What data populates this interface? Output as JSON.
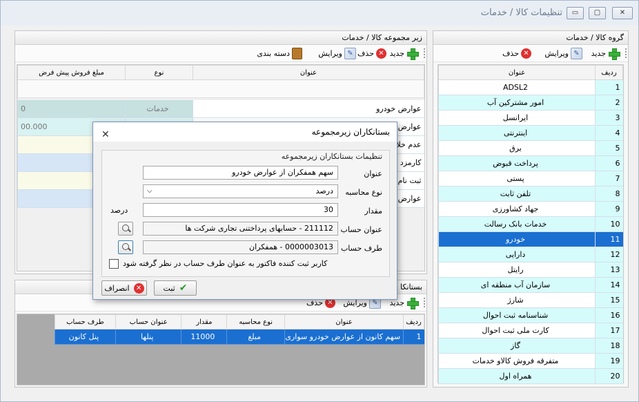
{
  "window": {
    "title": "تنظیمات کالا / خدمات",
    "btn_min": "▭",
    "btn_max": "▢",
    "btn_close": "✕"
  },
  "group_panel": {
    "title": "گروه کالا / خدمات",
    "toolbar": {
      "add": "جدید",
      "edit": "ویرایش",
      "delete": "حذف"
    },
    "columns": {
      "row": "ردیف",
      "title": "عنوان"
    },
    "rows": [
      {
        "n": "1",
        "t": "ADSL2"
      },
      {
        "n": "2",
        "t": "امور مشترکین آب"
      },
      {
        "n": "3",
        "t": "ایرانسل"
      },
      {
        "n": "4",
        "t": "اینترنتی"
      },
      {
        "n": "5",
        "t": "برق"
      },
      {
        "n": "6",
        "t": "پرداخت قبوض"
      },
      {
        "n": "7",
        "t": "پستی"
      },
      {
        "n": "8",
        "t": "تلفن ثابت"
      },
      {
        "n": "9",
        "t": "جهاد کشاورزی"
      },
      {
        "n": "10",
        "t": "خدمات بانک رسالت"
      },
      {
        "n": "11",
        "t": "خودرو"
      },
      {
        "n": "12",
        "t": "دارایی"
      },
      {
        "n": "13",
        "t": "رایتل"
      },
      {
        "n": "14",
        "t": "سازمان آب منطقه ای"
      },
      {
        "n": "15",
        "t": "شارژ"
      },
      {
        "n": "16",
        "t": "شناسنامه ثبت احوال"
      },
      {
        "n": "17",
        "t": "کارت ملی ثبت احوال"
      },
      {
        "n": "18",
        "t": "گاز"
      },
      {
        "n": "19",
        "t": "متفرقه فروش کالاو خدمات"
      },
      {
        "n": "20",
        "t": "همراه اول"
      }
    ]
  },
  "sub_panel": {
    "title": "زیر مجموعه کالا / خدمات",
    "toolbar": {
      "add": "جدید",
      "delete": "حذف",
      "edit": "ویرایش",
      "category": "دسته بندی"
    },
    "columns": {
      "title": "عنوان",
      "type": "نوع",
      "price": "مبلغ فروش پیش فرض"
    },
    "rows": [
      {
        "t": "عوارض خودرو",
        "type": "خدمات",
        "price": "0"
      },
      {
        "t": "عوارض خ",
        "type": "",
        "price": "00.000"
      },
      {
        "t": "عدم خلا",
        "type": "",
        "price": ""
      },
      {
        "t": "کارمزد پ",
        "type": "",
        "price": ""
      },
      {
        "t": "ثبت نام",
        "type": "",
        "price": ""
      },
      {
        "t": "عوارض",
        "type": "",
        "price": ""
      }
    ]
  },
  "creditors_panel": {
    "title": "بستانکا",
    "toolbar": {
      "add": "جدید",
      "edit": "ویرایش",
      "delete": "حذف"
    },
    "columns": {
      "row": "ردیف",
      "title": "عنوان",
      "calc": "نوع محاسبه",
      "amount": "مقدار",
      "acc": "عنوان حساب",
      "party": "طرف حساب"
    },
    "rows": [
      {
        "row": "1",
        "title": "سهم کانون از عوارض خودرو سواری",
        "calc": "مبلغ",
        "amount": "11000",
        "acc": "پنلها",
        "party": "پنل کانون"
      }
    ]
  },
  "dialog": {
    "title": "بستانکاران زیرمجموعه",
    "close": "✕",
    "group_label": "تنظیمات بستانکاران زیرمجموعه",
    "labels": {
      "title": "عنوان",
      "calc": "نوع محاسبه",
      "amount": "مقدار",
      "account": "عنوان حساب",
      "party": "طرف حساب"
    },
    "values": {
      "title": "سهم همفکران از عوارض خودرو",
      "calc": "درصد",
      "amount": "30",
      "amount_unit": "درصد",
      "account": "211112 - حسابهای  پرداختنی تجاری شرکت ها",
      "party": "0000003013 - همفکران"
    },
    "checkbox_label": "کاربر ثبت کننده فاکتور به عنوان طرف حساب در نظر گرفته شود",
    "save": "ثبت",
    "cancel": "انصراف"
  }
}
